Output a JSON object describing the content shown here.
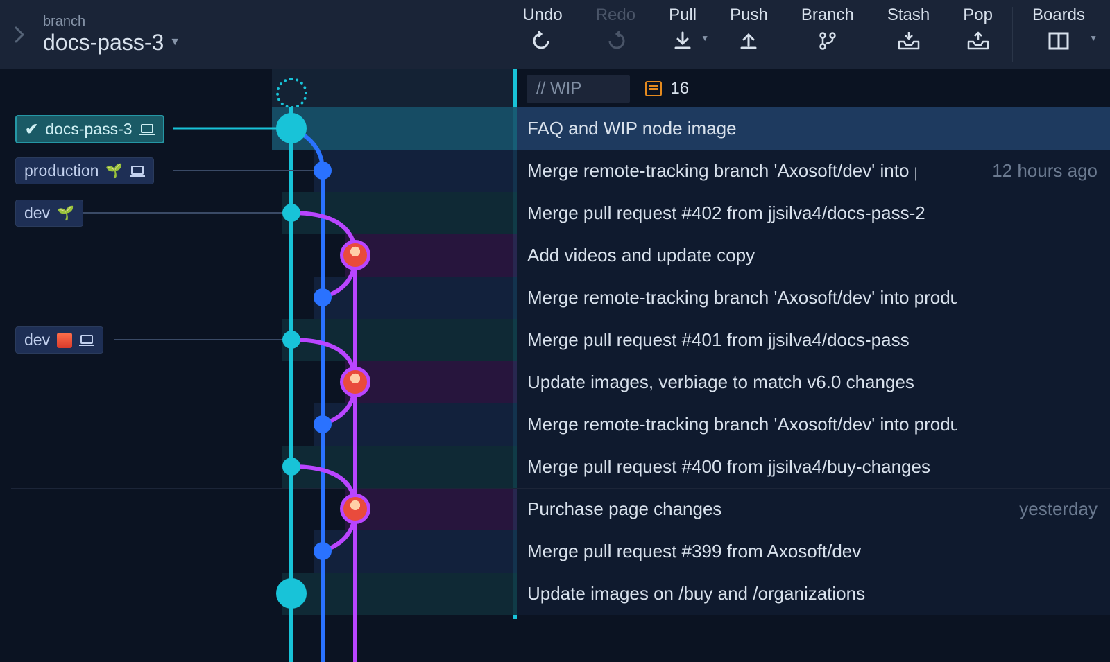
{
  "toolbar": {
    "branch_label": "branch",
    "branch_name": "docs-pass-3",
    "actions": {
      "undo": "Undo",
      "redo": "Redo",
      "pull": "Pull",
      "push": "Push",
      "branch": "Branch",
      "stash": "Stash",
      "pop": "Pop",
      "boards": "Boards"
    }
  },
  "wip": {
    "label": "// WIP",
    "file_count": "16"
  },
  "branches": {
    "docs_pass_3": "docs-pass-3",
    "production": "production",
    "dev": "dev",
    "dev_remote": "dev"
  },
  "commits": [
    {
      "msg": "FAQ and WIP node image",
      "time": ""
    },
    {
      "msg": "Merge remote-tracking branch 'Axosoft/dev' into pr…",
      "time": "12 hours ago"
    },
    {
      "msg": "Merge pull request #402 from jjsilva4/docs-pass-2",
      "time": ""
    },
    {
      "msg": "Add videos and update copy",
      "time": ""
    },
    {
      "msg": "Merge remote-tracking branch 'Axosoft/dev' into production",
      "time": ""
    },
    {
      "msg": "Merge pull request #401 from jjsilva4/docs-pass",
      "time": ""
    },
    {
      "msg": "Update images, verbiage to match v6.0 changes",
      "time": ""
    },
    {
      "msg": "Merge remote-tracking branch 'Axosoft/dev' into production",
      "time": ""
    },
    {
      "msg": "Merge pull request #400 from jjsilva4/buy-changes",
      "time": ""
    },
    {
      "msg": "Purchase page changes",
      "time": "yesterday"
    },
    {
      "msg": "Merge pull request #399 from Axosoft/dev",
      "time": ""
    },
    {
      "msg": "Update images on /buy and /organizations",
      "time": ""
    }
  ]
}
